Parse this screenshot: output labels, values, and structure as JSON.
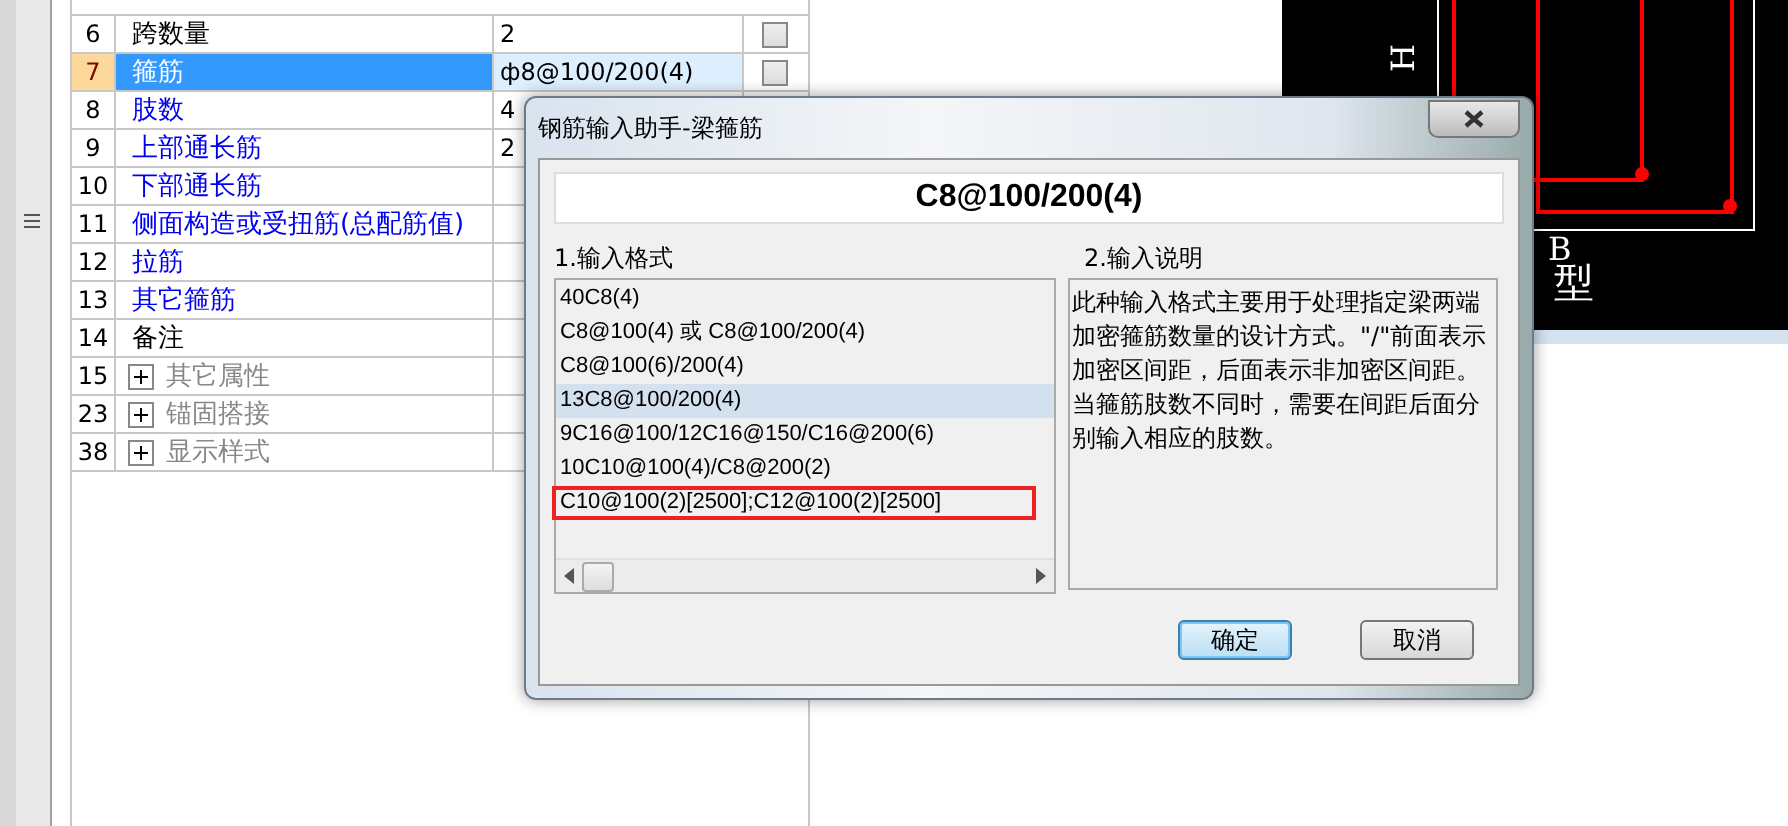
{
  "table": {
    "rows": [
      {
        "number": "6",
        "name": "跨数量",
        "value": "2",
        "kind": "plain",
        "selected": false,
        "checked": false
      },
      {
        "number": "7",
        "name": "箍筋",
        "value": "ф8@100/200(4)",
        "kind": "plain",
        "selected": true,
        "checked": false
      },
      {
        "number": "8",
        "name": "肢数",
        "value": "4",
        "kind": "link",
        "selected": false
      },
      {
        "number": "9",
        "name": "上部通长筋",
        "value": "2",
        "kind": "link",
        "selected": false
      },
      {
        "number": "10",
        "name": "下部通长筋",
        "kind": "link",
        "selected": false
      },
      {
        "number": "11",
        "name": "侧面构造或受扭筋(总配筋值)",
        "kind": "link",
        "selected": false
      },
      {
        "number": "12",
        "name": "拉筋",
        "kind": "link",
        "selected": false
      },
      {
        "number": "13",
        "name": "其它箍筋",
        "kind": "link",
        "selected": false
      },
      {
        "number": "14",
        "name": "备注",
        "kind": "plain",
        "selected": false
      },
      {
        "number": "15",
        "name": "其它属性",
        "kind": "group",
        "expanded": false,
        "selected": false
      },
      {
        "number": "23",
        "name": "锚固搭接",
        "kind": "group",
        "expanded": false,
        "selected": false
      },
      {
        "number": "38",
        "name": "显示样式",
        "kind": "group",
        "expanded": false,
        "selected": false
      }
    ]
  },
  "cad": {
    "labels": [
      "H",
      "B",
      "型"
    ]
  },
  "dialog": {
    "title": "钢筋输入助手-梁箍筋",
    "preview": "C8@100/200(4)",
    "formats": {
      "label": "1.输入格式",
      "items": [
        {
          "text": "40C8(4)",
          "selected": false,
          "annotated": false
        },
        {
          "text": "C8@100(4) 或 C8@100/200(4)",
          "selected": false,
          "annotated": false
        },
        {
          "text": "C8@100(6)/200(4)",
          "selected": false,
          "annotated": false
        },
        {
          "text": "13C8@100/200(4)",
          "selected": true,
          "annotated": false
        },
        {
          "text": "9C16@100/12C16@150/C16@200(6)",
          "selected": false,
          "annotated": false
        },
        {
          "text": "10C10@100(4)/C8@200(2)",
          "selected": false,
          "annotated": false
        },
        {
          "text": "C10@100(2)[2500];C12@100(2)[2500]",
          "selected": false,
          "annotated": true
        }
      ]
    },
    "description": {
      "label": "2.输入说明",
      "text": "此种输入格式主要用于处理指定梁两端加密箍筋数量的设计方式。\"/\"前面表示加密区间距，后面表示非加密区间距。当箍筋肢数不同时，需要在间距后面分别输入相应的肢数。"
    },
    "buttons": [
      {
        "label": "确定",
        "default": true
      },
      {
        "label": "取消",
        "default": false
      }
    ]
  }
}
